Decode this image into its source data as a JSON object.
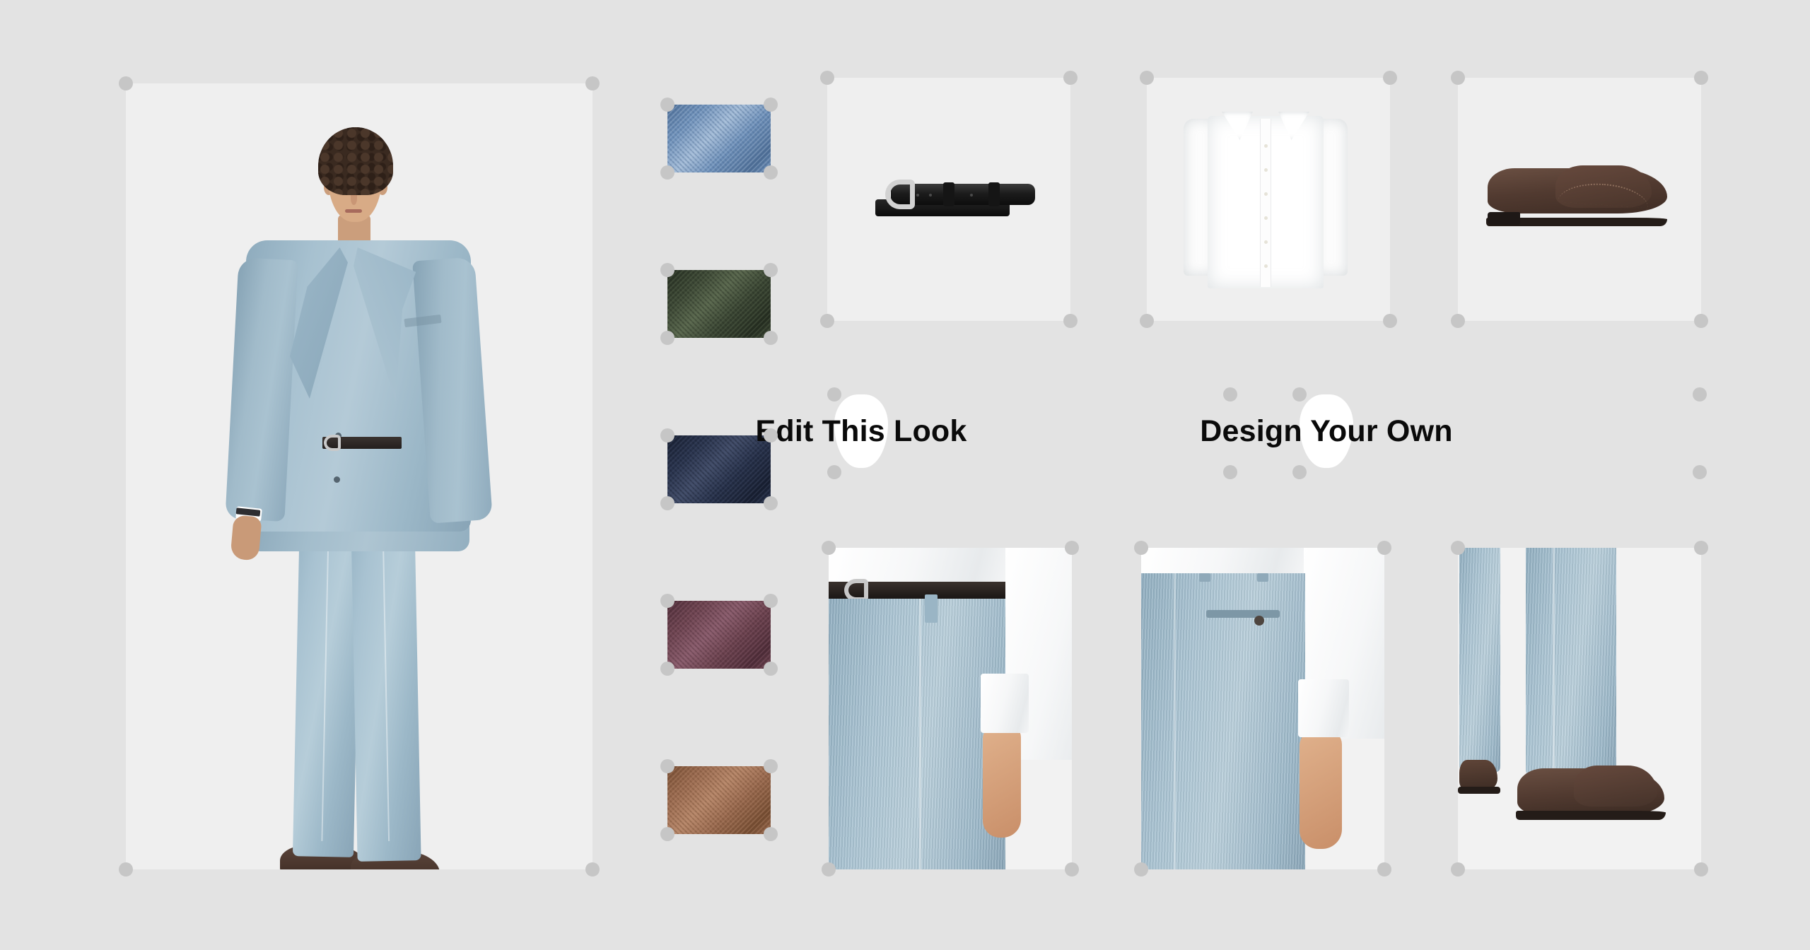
{
  "canvas": {
    "background_color": "#e3e3e3",
    "tile_color": "#efefef",
    "handle_color": "#c6c6c6"
  },
  "hero": {
    "name": "model-look-photo",
    "alt": "Model wearing light blue linen suit with white shirt, navy medallion tie, black belt and brown suede loafers",
    "suit_color": "#a9c3d2",
    "shirt_color": "#ffffff",
    "tie_color": "#1f2734",
    "belt_color": "#241f1d",
    "shoe_color": "#4a362d"
  },
  "swatches": {
    "label": "Fabric swatches",
    "items": [
      {
        "name": "light-blue-linen",
        "label": "Light Blue Linen",
        "color": "#6d8fb8",
        "highlight": "#a9c0da",
        "shadow": "#4a6a92"
      },
      {
        "name": "dark-green-linen",
        "label": "Dark Green Linen",
        "color": "#3b4634",
        "highlight": "#5d6b51",
        "shadow": "#232b1f"
      },
      {
        "name": "navy-linen",
        "label": "Navy Linen",
        "color": "#28324b",
        "highlight": "#45506c",
        "shadow": "#161d2e"
      },
      {
        "name": "burgundy-linen",
        "label": "Burgundy Linen",
        "color": "#6d4450",
        "highlight": "#8d6070",
        "shadow": "#4a2a35"
      },
      {
        "name": "tan-brown-linen",
        "label": "Tan Brown Linen",
        "color": "#9a6b51",
        "highlight": "#b98a6d",
        "shadow": "#70492f"
      }
    ]
  },
  "products": [
    {
      "name": "belt-product-tile",
      "label": "Black Leather Belt",
      "alt": "Black pebbled leather belt with silver buckle"
    },
    {
      "name": "shirt-product-tile",
      "label": "White Dress Shirt",
      "alt": "White cotton dress shirt with spread collar"
    },
    {
      "name": "shoe-product-tile",
      "label": "Brown Suede Loafer",
      "alt": "Dark brown suede slip-on loafer"
    }
  ],
  "actions": {
    "edit_look": {
      "name": "edit-this-look-button",
      "label": "Edit This Look"
    },
    "design_own": {
      "name": "design-your-own-button",
      "label": "Design Your Own"
    }
  },
  "details": [
    {
      "name": "waist-front-detail",
      "label": "Front waist with belt and pleat detail"
    },
    {
      "name": "back-pocket-detail",
      "label": "Rear welt pocket with button detail"
    },
    {
      "name": "hem-shoe-detail",
      "label": "Trouser hem with brown suede loafer"
    }
  ]
}
